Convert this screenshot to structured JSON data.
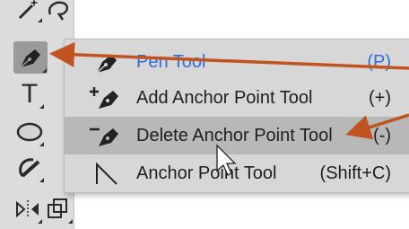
{
  "toolbar": {
    "tools": [
      {
        "name": "magic-wand-tool",
        "text": ""
      },
      {
        "name": "lasso-tool",
        "text": ""
      },
      {
        "name": "pen-tool",
        "text": ""
      },
      {
        "name": "type-tool",
        "text": "T"
      },
      {
        "name": "ellipse-tool",
        "text": ""
      },
      {
        "name": "shaper-tool",
        "text": ""
      },
      {
        "name": "width-tool",
        "text": ""
      },
      {
        "name": "free-transform-tool",
        "text": ""
      }
    ]
  },
  "flyout": {
    "items": [
      {
        "label": "Pen Tool",
        "shortcut": "(P)",
        "icon": "pen-icon",
        "state": "current"
      },
      {
        "label": "Add Anchor Point Tool",
        "shortcut": "(+)",
        "icon": "add-anchor-point-icon",
        "state": "normal"
      },
      {
        "label": "Delete Anchor Point Tool",
        "shortcut": "(-)",
        "icon": "delete-anchor-point-icon",
        "state": "highlighted"
      },
      {
        "label": "Anchor Point Tool",
        "shortcut": "(Shift+C)",
        "icon": "anchor-point-icon",
        "state": "normal"
      }
    ]
  },
  "annotations": {
    "arrow_color": "#c0531f",
    "arrow_count": 2
  },
  "colors": {
    "toolbar_bg": "#dcdcdc",
    "menu_bg": "#d7d7d7",
    "highlight_bg": "#b8b8b8",
    "current_text": "#2f6fd6"
  }
}
